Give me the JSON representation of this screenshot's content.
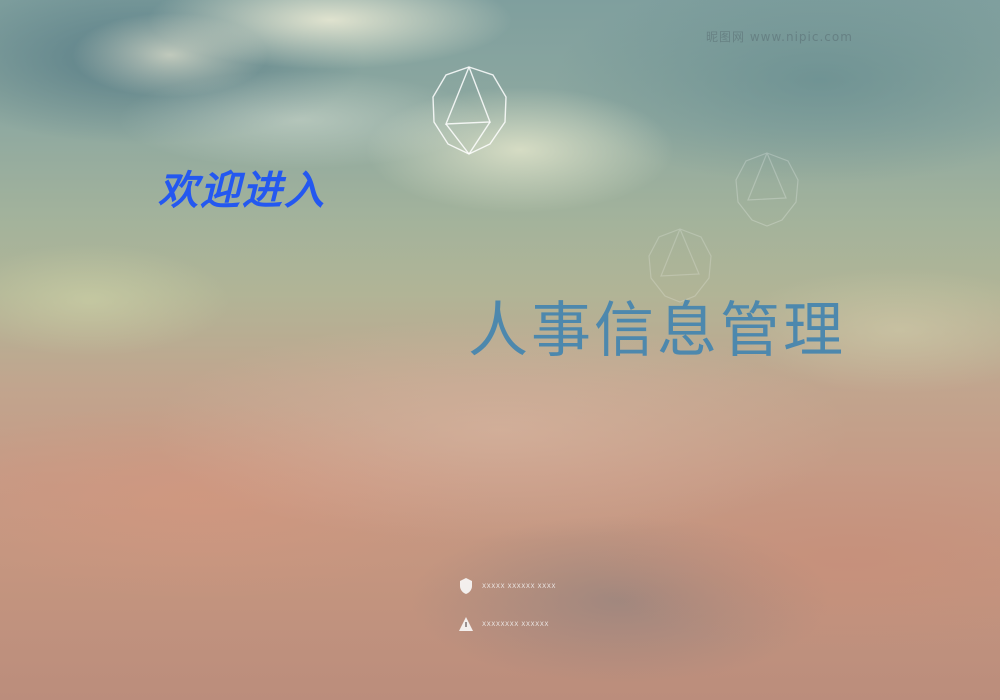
{
  "watermark": "昵图网 www.nipic.com",
  "welcome_text": "欢迎进入",
  "system_title": "人事信息管理",
  "footer": {
    "items": [
      {
        "icon": "shield-icon",
        "text": "XXXXX XXXXXX XXXX"
      },
      {
        "icon": "warning-triangle-icon",
        "text": "XXXXXXXX XXXXXX"
      }
    ]
  },
  "colors": {
    "welcome": "#2458f0",
    "title": "#4d88ad"
  }
}
